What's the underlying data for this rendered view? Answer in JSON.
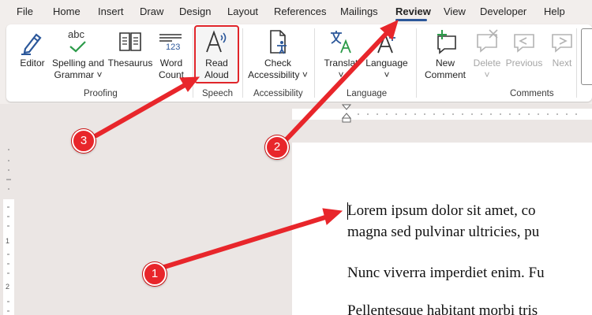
{
  "menu": {
    "tabs": [
      "File",
      "Home",
      "Insert",
      "Draw",
      "Design",
      "Layout",
      "References",
      "Mailings",
      "Review",
      "View",
      "Developer",
      "Help"
    ],
    "active": "Review"
  },
  "ribbon": {
    "proofing": {
      "label": "Proofing",
      "editor": "Editor",
      "spelling_line1": "Spelling and",
      "spelling_line2": "Grammar ˅",
      "spelling_icon_text": "abc",
      "thesaurus": "Thesaurus",
      "wordcount_line1": "Word",
      "wordcount_line2": "Count",
      "wordcount_icon_text": "123"
    },
    "speech": {
      "label": "Speech",
      "read_line1": "Read",
      "read_line2": "Aloud"
    },
    "accessibility": {
      "label": "Accessibility",
      "check_line1": "Check",
      "check_line2": "Accessibility ˅"
    },
    "language": {
      "label": "Language",
      "translate": "Translat",
      "language": "Language",
      "chevron": "˅"
    },
    "comments": {
      "label": "Comments",
      "new_line1": "New",
      "new_line2": "Comment",
      "delete": "Delete",
      "previous": "Previous",
      "next": "Next"
    }
  },
  "ruler": {
    "vertical_numbers": [
      "1",
      "2"
    ]
  },
  "document": {
    "lines": [
      "Lorem ipsum dolor sit amet, co",
      "magna sed pulvinar ultricies, pu",
      "Nunc viverra imperdiet enim. Fu",
      "Pellentesque habitant morbi tris"
    ]
  },
  "annotations": {
    "markers": [
      "1",
      "2",
      "3"
    ],
    "color": "#e8262b"
  }
}
